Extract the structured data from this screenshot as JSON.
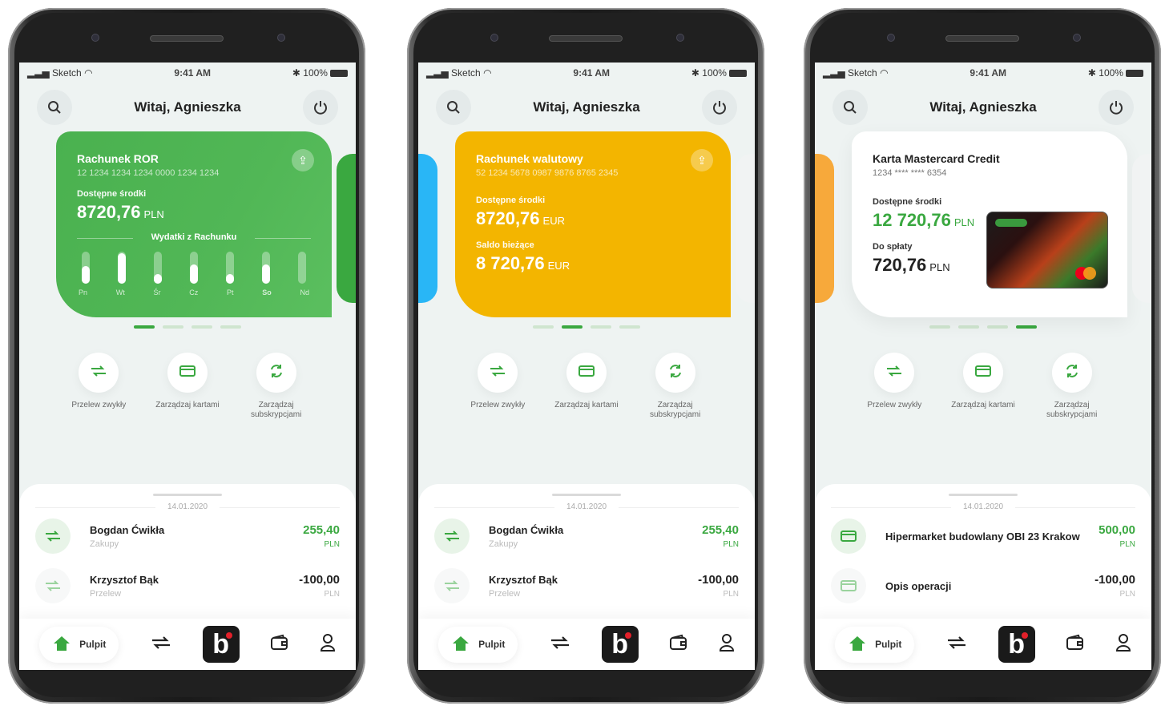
{
  "status": {
    "carrier": "Sketch",
    "time": "9:41 AM",
    "battery": "100%"
  },
  "phones": [
    {
      "greeting": "Witaj, Agnieszka",
      "card": {
        "title": "Rachunek ROR",
        "number": "12 1234 1234 1234 0000 1234 1234",
        "available_label": "Dostępne środki",
        "available_value": "8720,76",
        "currency": "PLN",
        "spending_title": "Wydatki z Rachunku",
        "days": [
          "Pn",
          "Wt",
          "Śr",
          "Cz",
          "Pt",
          "So",
          "Nd"
        ],
        "bar_levels": [
          0.55,
          0.95,
          0.3,
          0.6,
          0.3,
          0.6,
          0.0
        ]
      },
      "active_dot": 0,
      "date": "14.01.2020",
      "tx": [
        {
          "name": "Bogdan Ćwikła",
          "sub": "Zakupy",
          "amount": "255,40",
          "currency": "PLN",
          "positive": true
        },
        {
          "name": "Krzysztof Bąk",
          "sub": "Przelew",
          "amount": "-100,00",
          "currency": "PLN",
          "positive": false
        }
      ]
    },
    {
      "greeting": "Witaj, Agnieszka",
      "card": {
        "title": "Rachunek walutowy",
        "number": "52 1234 5678 0987 9876 8765 2345",
        "available_label": "Dostępne środki",
        "available_value": "8720,76",
        "currency": "EUR",
        "balance_label": "Saldo bieżące",
        "balance_value": "8 720,76",
        "balance_currency": "EUR"
      },
      "active_dot": 1,
      "date": "14.01.2020",
      "tx": [
        {
          "name": "Bogdan Ćwikła",
          "sub": "Zakupy",
          "amount": "255,40",
          "currency": "PLN",
          "positive": true
        },
        {
          "name": "Krzysztof Bąk",
          "sub": "Przelew",
          "amount": "-100,00",
          "currency": "PLN",
          "positive": false
        }
      ]
    },
    {
      "greeting": "Witaj, Agnieszka",
      "card": {
        "title": "Karta Mastercard Credit",
        "number": "1234 **** **** 6354",
        "available_label": "Dostępne środki",
        "available_value": "12 720,76",
        "currency": "PLN",
        "due_label": "Do spłaty",
        "due_value": "720,76",
        "due_currency": "PLN"
      },
      "active_dot": 3,
      "date": "14.01.2020",
      "tx": [
        {
          "name": "Hipermarket budowlany OBI 23 Krakow",
          "sub": "",
          "amount": "500,00",
          "currency": "PLN",
          "positive": true
        },
        {
          "name": "Opis operacji",
          "sub": "",
          "amount": "-100,00",
          "currency": "PLN",
          "positive": false
        }
      ]
    }
  ],
  "actions": [
    {
      "label": "Przelew zwykły",
      "icon": "transfer-icon"
    },
    {
      "label": "Zarządzaj kartami",
      "icon": "card-icon"
    },
    {
      "label": "Zarządzaj subskrypcjami",
      "icon": "refresh-icon"
    }
  ],
  "nav": {
    "home_label": "Pulpit",
    "brand_letter": "b"
  },
  "colors": {
    "green": "#4ab14f",
    "yellow": "#f3b500",
    "accent": "#3aa840",
    "blue": "#29b6f6",
    "orange": "#f7a93b"
  }
}
